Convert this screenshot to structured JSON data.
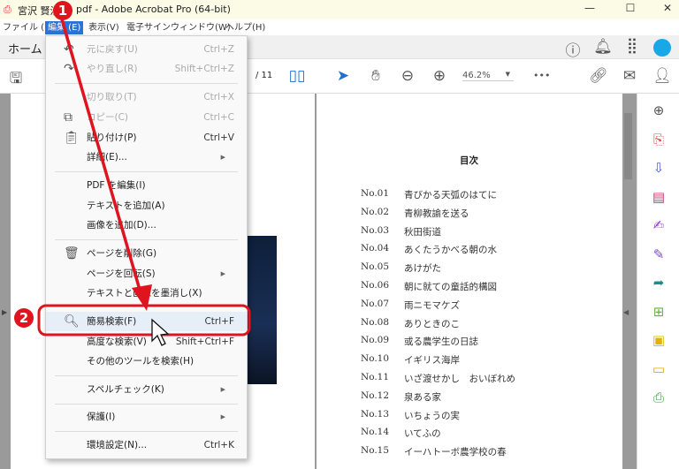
{
  "window": {
    "title_prefix": "宮沢 賢治",
    "title_suffix": "pdf - Adobe Acrobat Pro (64-bit)",
    "minimize": "—",
    "maximize": "☐",
    "close": "✕"
  },
  "menubar": [
    {
      "label": "ファイル (F)"
    },
    {
      "label": "編集 (E)",
      "active": true
    },
    {
      "label": "表示(V)"
    },
    {
      "label": "電子サイン"
    },
    {
      "label": "ウィンドウ(W)"
    },
    {
      "label": "ヘルプ(H)"
    }
  ],
  "tabs": {
    "home": "ホーム"
  },
  "toolbar": {
    "page_total": "/ 11",
    "zoom": "46.2%",
    "more": "•••"
  },
  "edit_menu": {
    "items": [
      {
        "label": "元に戻す(U)",
        "shortcut": "Ctrl+Z",
        "disabled": true,
        "icon": "undo-icon"
      },
      {
        "label": "やり直し(R)",
        "shortcut": "Shift+Ctrl+Z",
        "disabled": true,
        "icon": "redo-icon"
      },
      {
        "label": "切り取り(T)",
        "shortcut": "Ctrl+X",
        "disabled": true
      },
      {
        "label": "コピー(C)",
        "shortcut": "Ctrl+C",
        "disabled": true,
        "icon": "copy-icon"
      },
      {
        "label": "貼り付け(P)",
        "shortcut": "Ctrl+V",
        "icon": "clipboard-icon"
      },
      {
        "label": "詳細(E)...",
        "submenu": true
      },
      {
        "label": "PDF を編集(I)"
      },
      {
        "label": "テキストを追加(A)"
      },
      {
        "label": "画像を追加(D)..."
      },
      {
        "label": "ページを削除(G)",
        "icon": "trash-icon"
      },
      {
        "label": "ページを回転(S)",
        "submenu": true
      },
      {
        "label": "テキストと画像を墨消し(X)"
      },
      {
        "label": "簡易検索(F)",
        "shortcut": "Ctrl+F",
        "icon": "search-icon",
        "highlighted": true
      },
      {
        "label": "高度な検索(V)",
        "shortcut": "Shift+Ctrl+F"
      },
      {
        "label": "その他のツールを検索(H)"
      },
      {
        "label": "スペルチェック(K)",
        "submenu": true
      },
      {
        "label": "保護(I)",
        "submenu": true
      },
      {
        "label": "環境設定(N)...",
        "shortcut": "Ctrl+K"
      }
    ]
  },
  "annotations": {
    "step1": "1",
    "step2": "2",
    "color": "#e0141e"
  },
  "document": {
    "toc_title": "目次",
    "toc": [
      {
        "no": "No.01",
        "title": "青びかる天弧のはてに"
      },
      {
        "no": "No.02",
        "title": "青柳教諭を送る"
      },
      {
        "no": "No.03",
        "title": "秋田街道"
      },
      {
        "no": "No.04",
        "title": "あくたうかべる朝の水"
      },
      {
        "no": "No.05",
        "title": "あけがた"
      },
      {
        "no": "No.06",
        "title": "朝に就ての童話的構図"
      },
      {
        "no": "No.07",
        "title": "雨ニモマケズ"
      },
      {
        "no": "No.08",
        "title": "ありときのこ"
      },
      {
        "no": "No.09",
        "title": "或る農学生の日誌"
      },
      {
        "no": "No.10",
        "title": "イギリス海岸"
      },
      {
        "no": "No.11",
        "title": "いざ渡せかし　おいぼれめ"
      },
      {
        "no": "No.12",
        "title": "泉ある家"
      },
      {
        "no": "No.13",
        "title": "いちょうの実"
      },
      {
        "no": "No.14",
        "title": "いてふの"
      },
      {
        "no": "No.15",
        "title": "イーハトーボ農学校の春"
      }
    ]
  },
  "right_tools": [
    {
      "icon": "zoom-search-icon",
      "color": "#555555"
    },
    {
      "icon": "create-pdf-icon",
      "color": "#e0434b"
    },
    {
      "icon": "export-pdf-icon",
      "color": "#4b5fd6"
    },
    {
      "icon": "organize-pages-icon",
      "color": "#d6336c"
    },
    {
      "icon": "request-signature-icon",
      "color": "#9b3bd1"
    },
    {
      "icon": "fill-sign-icon",
      "color": "#7a48d6"
    },
    {
      "icon": "send-pdf-icon",
      "color": "#1a8f8a"
    },
    {
      "icon": "compress-icon",
      "color": "#5cb82e"
    },
    {
      "icon": "protect-pdf-icon",
      "color": "#e0b400"
    },
    {
      "icon": "comment-icon",
      "color": "#e0a800"
    },
    {
      "icon": "print-production-icon",
      "color": "#3ba84a"
    }
  ]
}
